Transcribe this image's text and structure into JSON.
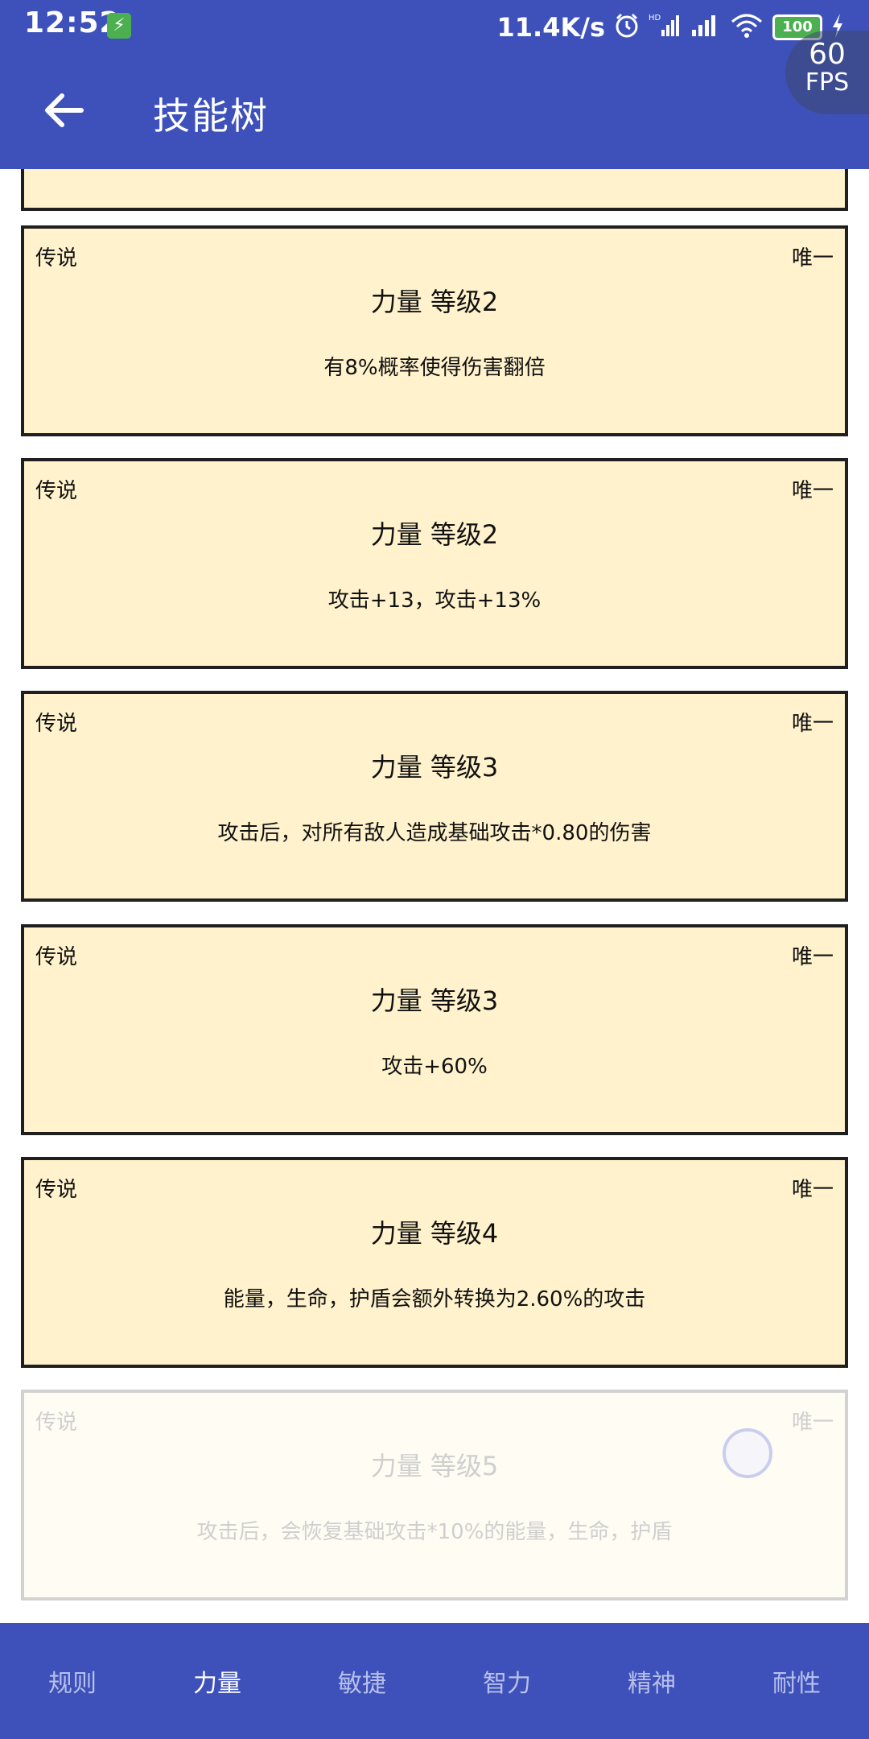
{
  "status_bar": {
    "time": "12:52",
    "charging_glyph": "⚡",
    "net_speed": "11.4K/s",
    "battery_level": "100",
    "fps_value": "60",
    "fps_label": "FPS",
    "icons": [
      "charging-icon",
      "alarm-icon",
      "hd-signal-icon",
      "signal-icon",
      "wifi-icon",
      "battery-icon",
      "bolt-icon"
    ]
  },
  "app_bar": {
    "title": "技能树",
    "back_icon": "arrow-left-icon"
  },
  "cards": [
    {
      "rarity": "传说",
      "unique": "唯一",
      "title": "力量 等级2",
      "desc": "有8%概率使得伤害翻倍"
    },
    {
      "rarity": "传说",
      "unique": "唯一",
      "title": "力量 等级2",
      "desc": "攻击+13，攻击+13%"
    },
    {
      "rarity": "传说",
      "unique": "唯一",
      "title": "力量 等级3",
      "desc": "攻击后，对所有敌人造成基础攻击*0.80的伤害"
    },
    {
      "rarity": "传说",
      "unique": "唯一",
      "title": "力量 等级3",
      "desc": "攻击+60%"
    },
    {
      "rarity": "传说",
      "unique": "唯一",
      "title": "力量 等级4",
      "desc": "能量，生命，护盾会额外转换为2.60%的攻击"
    },
    {
      "rarity": "传说",
      "unique": "唯一",
      "title": "力量 等级5",
      "desc": "攻击后，会恢复基础攻击*10%的能量，生命，护盾",
      "locked": true
    }
  ],
  "tabs": [
    {
      "label": "规则",
      "active": false
    },
    {
      "label": "力量",
      "active": true
    },
    {
      "label": "敏捷",
      "active": false
    },
    {
      "label": "智力",
      "active": false
    },
    {
      "label": "精神",
      "active": false
    },
    {
      "label": "耐性",
      "active": false
    }
  ],
  "colors": {
    "primary": "#3e51bb",
    "card_bg": "#fff2cc",
    "card_border": "#1f1f1f",
    "locked_text": "#cfcfcf"
  }
}
